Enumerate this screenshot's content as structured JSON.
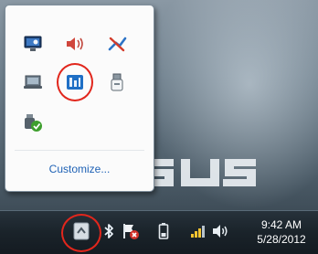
{
  "tray_overflow": {
    "icons": [
      {
        "name": "display-settings-icon"
      },
      {
        "name": "speaker-muted-icon"
      },
      {
        "name": "network-disconnected-icon"
      },
      {
        "name": "laptop-display-icon"
      },
      {
        "name": "wireless-console-icon",
        "highlighted": true
      },
      {
        "name": "usb-device-icon"
      },
      {
        "name": "power-check-icon"
      }
    ],
    "customize_label": "Customize..."
  },
  "taskbar": {
    "show_hidden_icons": {
      "name": "show-hidden-icons-arrow",
      "highlighted": true
    },
    "tray_icons": [
      {
        "name": "bluetooth-icon"
      },
      {
        "name": "action-center-flag-icon"
      },
      {
        "name": "battery-icon"
      },
      {
        "name": "network-signal-icon"
      },
      {
        "name": "volume-icon"
      }
    ],
    "clock": {
      "time": "9:42 AM",
      "date": "5/28/2012"
    }
  },
  "desktop": {
    "logo_text": "ASUS"
  },
  "colors": {
    "highlight_ring": "#e1261c",
    "link": "#1f62b5",
    "taskbar": "#1a232a"
  }
}
